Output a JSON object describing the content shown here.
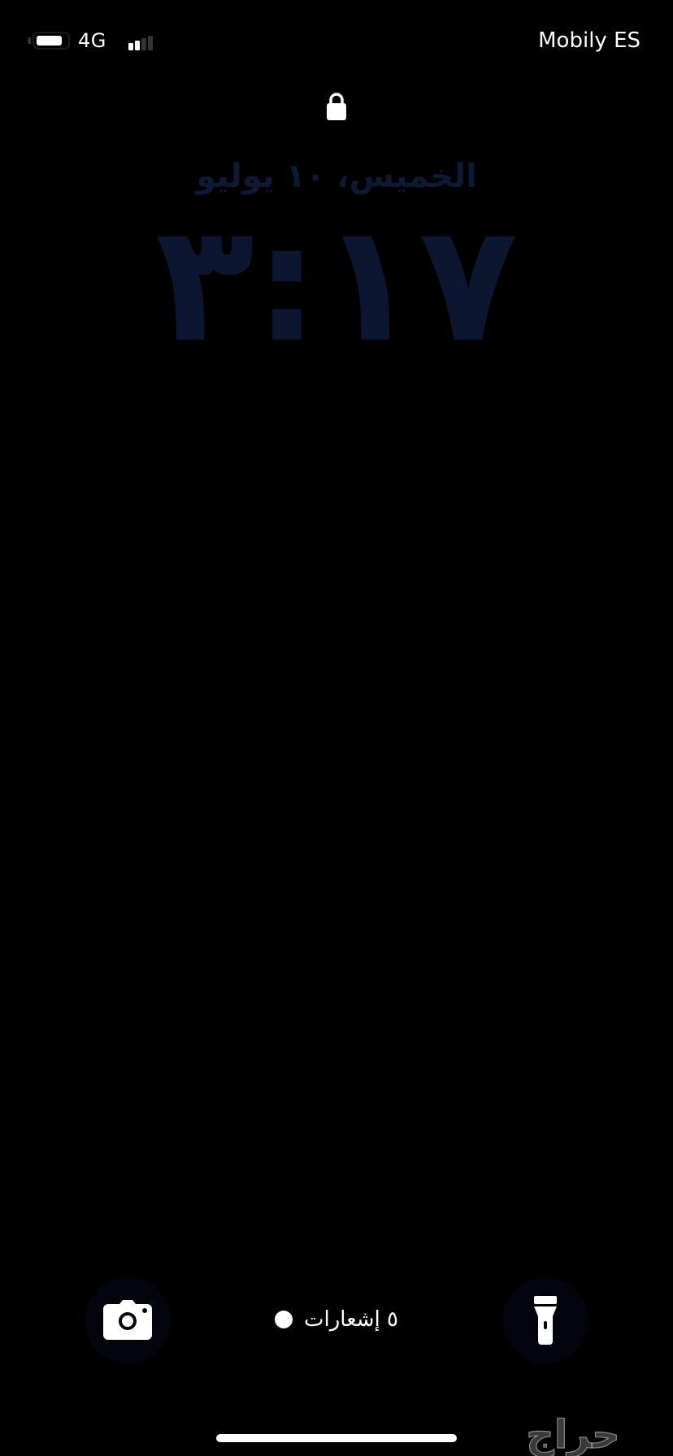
{
  "status_bar": {
    "network_type": "4G",
    "carrier": "Mobily ES",
    "battery_level": 0.85,
    "signal_bars_active": 2,
    "signal_bars_total": 4
  },
  "lock_screen": {
    "date": "الخميس، ١٠ يوليو",
    "time": "٣:١٧",
    "notifications_label": "٥ إشعارات"
  },
  "icons": {
    "lock": "lock-icon",
    "camera": "camera-icon",
    "flashlight": "flashlight-icon",
    "watermark": "haraj-logo"
  },
  "colors": {
    "background": "#000000",
    "clock_text": "#0b1730",
    "foreground": "#ffffff"
  },
  "watermark_text": "حراج"
}
